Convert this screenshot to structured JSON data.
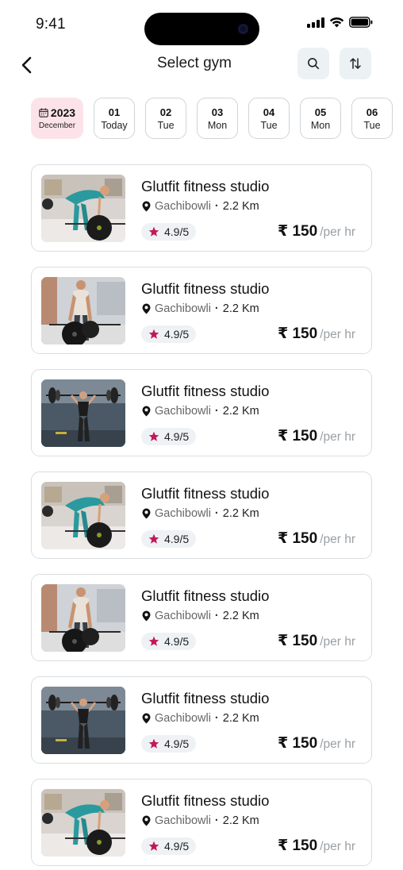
{
  "status_bar": {
    "time": "9:41"
  },
  "header": {
    "title": "Select gym"
  },
  "date_strip": {
    "year": "2023",
    "month": "December",
    "dates": [
      {
        "num": "01",
        "day": "Today"
      },
      {
        "num": "02",
        "day": "Tue"
      },
      {
        "num": "03",
        "day": "Mon"
      },
      {
        "num": "04",
        "day": "Tue"
      },
      {
        "num": "05",
        "day": "Mon"
      },
      {
        "num": "06",
        "day": "Tue"
      }
    ]
  },
  "gyms": [
    {
      "name": "Glutfit fitness studio",
      "area": "Gachibowli",
      "distance": "2.2 Km",
      "rating": "4.9/5",
      "price": "₹ 150",
      "price_unit": "/per hr",
      "image": "deadlift-teal"
    },
    {
      "name": "Glutfit fitness studio",
      "area": "Gachibowli",
      "distance": "2.2 Km",
      "rating": "4.9/5",
      "price": "₹ 150",
      "price_unit": "/per hr",
      "image": "deadlift-man"
    },
    {
      "name": "Glutfit fitness studio",
      "area": "Gachibowli",
      "distance": "2.2 Km",
      "rating": "4.9/5",
      "price": "₹ 150",
      "price_unit": "/per hr",
      "image": "barbell-woman"
    },
    {
      "name": "Glutfit fitness studio",
      "area": "Gachibowli",
      "distance": "2.2 Km",
      "rating": "4.9/5",
      "price": "₹ 150",
      "price_unit": "/per hr",
      "image": "deadlift-teal"
    },
    {
      "name": "Glutfit fitness studio",
      "area": "Gachibowli",
      "distance": "2.2 Km",
      "rating": "4.9/5",
      "price": "₹ 150",
      "price_unit": "/per hr",
      "image": "deadlift-man"
    },
    {
      "name": "Glutfit fitness studio",
      "area": "Gachibowli",
      "distance": "2.2 Km",
      "rating": "4.9/5",
      "price": "₹ 150",
      "price_unit": "/per hr",
      "image": "barbell-woman"
    },
    {
      "name": "Glutfit fitness studio",
      "area": "Gachibowli",
      "distance": "2.2 Km",
      "rating": "4.9/5",
      "price": "₹ 150",
      "price_unit": "/per hr",
      "image": "deadlift-teal"
    }
  ],
  "colors": {
    "accent_pink": "#fce3ea",
    "star": "#c2185b",
    "chip_bg": "#ecf1f4"
  },
  "icons": [
    "back-arrow-icon",
    "search-icon",
    "sort-icon",
    "calendar-icon",
    "location-pin-icon",
    "star-icon"
  ]
}
